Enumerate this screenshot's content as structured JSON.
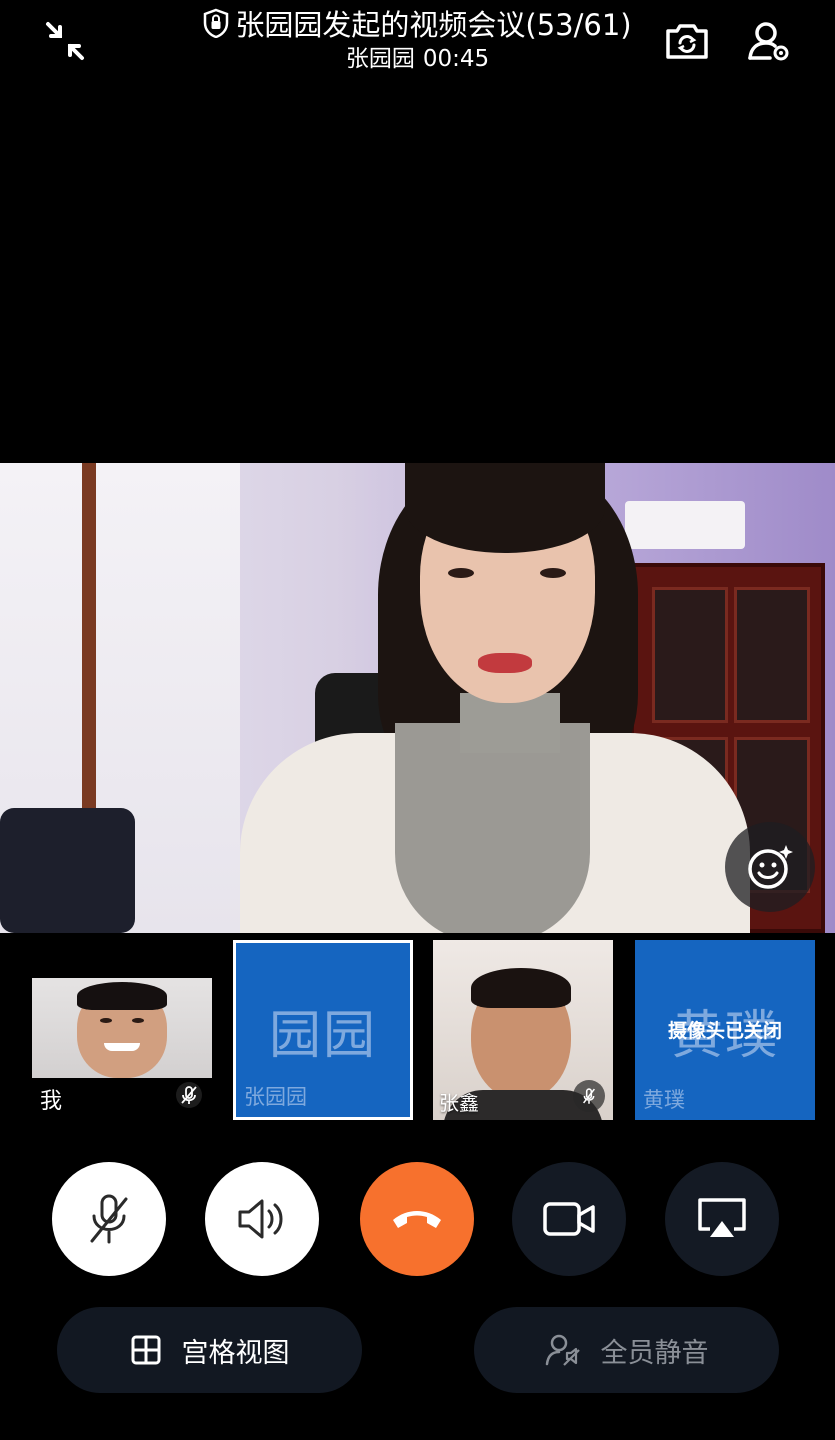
{
  "header": {
    "title": "张园园发起的视频会议(53/61)",
    "host_name": "张园园",
    "duration": "00:45"
  },
  "thumbnails": [
    {
      "name": "我",
      "mic_muted": true
    },
    {
      "avatar_text": "园园",
      "name": "张园园",
      "is_speaker": true
    },
    {
      "name": "张鑫",
      "mic_muted": true
    },
    {
      "avatar_text": "黄璞",
      "name": "黄璞",
      "status": "摄像头已关闭"
    }
  ],
  "controls": {
    "mic": "mic-off",
    "speaker": "speaker-on",
    "hangup": "hang-up",
    "camera": "camera",
    "share": "screen-share"
  },
  "bottom_buttons": {
    "grid_view": "宫格视图",
    "mute_all": "全员静音"
  },
  "colors": {
    "background": "#000000",
    "hangup": "#f7712d",
    "avatar_tile": "#1565c0",
    "control_dark": "#141a24"
  }
}
